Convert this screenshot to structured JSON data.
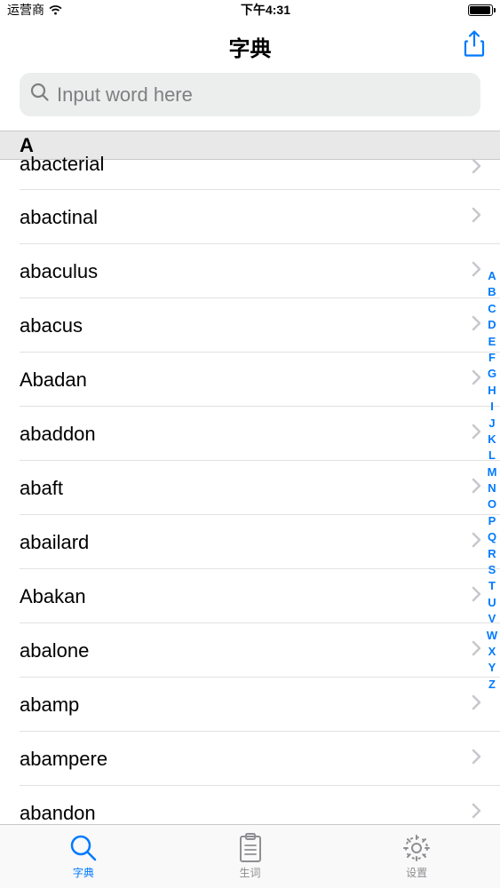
{
  "status": {
    "carrier": "运营商",
    "time": "下午4:31"
  },
  "nav": {
    "title": "字典"
  },
  "search": {
    "placeholder": "Input word here"
  },
  "section": {
    "header": "A"
  },
  "words": [
    "abacterial",
    "abactinal",
    "abaculus",
    "abacus",
    "Abadan",
    "abaddon",
    "abaft",
    "abailard",
    "Abakan",
    "abalone",
    "abamp",
    "abampere",
    "abandon"
  ],
  "index": [
    "A",
    "B",
    "C",
    "D",
    "E",
    "F",
    "G",
    "H",
    "I",
    "J",
    "K",
    "L",
    "M",
    "N",
    "O",
    "P",
    "Q",
    "R",
    "S",
    "T",
    "U",
    "V",
    "W",
    "X",
    "Y",
    "Z"
  ],
  "tabs": [
    {
      "label": "字典",
      "active": true
    },
    {
      "label": "生词",
      "active": false
    },
    {
      "label": "设置",
      "active": false
    }
  ]
}
